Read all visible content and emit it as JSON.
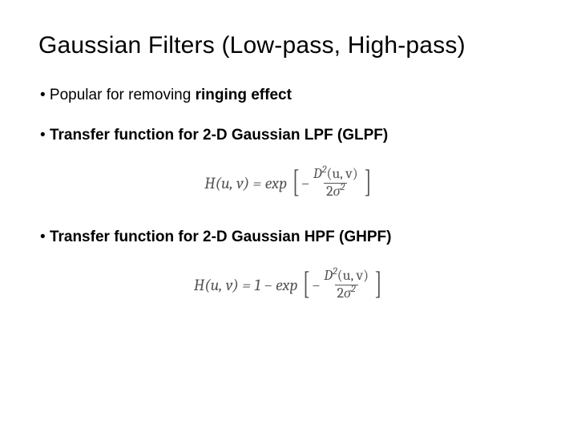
{
  "title": "Gaussian Filters (Low-pass, High-pass)",
  "bullets": {
    "b1_lead": "• Popular for removing ",
    "b1_bold": "ringing effect",
    "b2_lead": "• ",
    "b2_bold": "Transfer function for 2-D Gaussian LPF (GLPF)",
    "b3_lead": "• ",
    "b3_bold": "Transfer function for 2-D Gaussian HPF (GHPF)"
  },
  "formulas": {
    "lpf": {
      "lhs": "H(u, v) = exp",
      "minus": "−",
      "num_a": "D",
      "num_sup": "2",
      "num_b": "(u, v)",
      "den_a": "2",
      "den_sig": "σ",
      "den_sup": "2"
    },
    "hpf": {
      "lhs": "H(u, v) = 1 − exp",
      "minus": "−",
      "num_a": "D",
      "num_sup": "2",
      "num_b": "(u, v)",
      "den_a": "2",
      "den_sig": "σ",
      "den_sup": "2"
    }
  }
}
